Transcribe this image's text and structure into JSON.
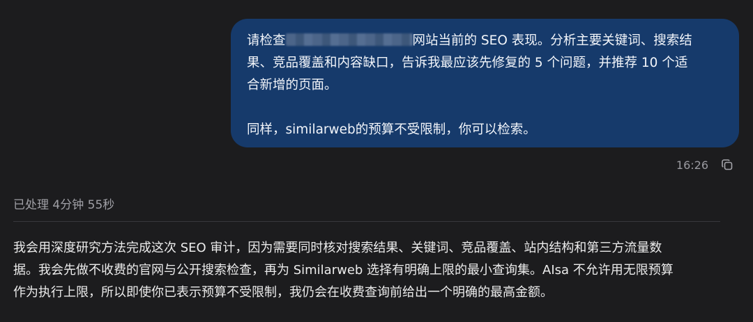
{
  "user_message": {
    "line1_prefix": "请检查",
    "line1_suffix": "网站当前的 SEO 表现。分析主要关键词、搜索结",
    "line2": "果、竞品覆盖和内容缺口，告诉我最应该先修复的 5 个问题，并推荐 10 个适",
    "line3": "合新增的页面。",
    "line4": "同样，similarweb的预算不受限制，你可以检索。"
  },
  "meta": {
    "time": "16:26",
    "copy_icon": "copy-icon"
  },
  "status": {
    "processed": "已处理 4分钟 55秒"
  },
  "assistant_reply": {
    "line1": "我会用深度研究方法完成这次 SEO 审计，因为需要同时核对搜索结果、关键词、竞品覆盖、站内结构和第三方流量数",
    "line2": "据。我会先做不收费的官网与公开搜索检查，再为 Similarweb 选择有明确上限的最小查询集。AIsa 不允许用无限预算",
    "line3": "作为执行上限，所以即使你已表示预算不受限制，我仍会在收费查询前给出一个明确的最高金额。"
  }
}
